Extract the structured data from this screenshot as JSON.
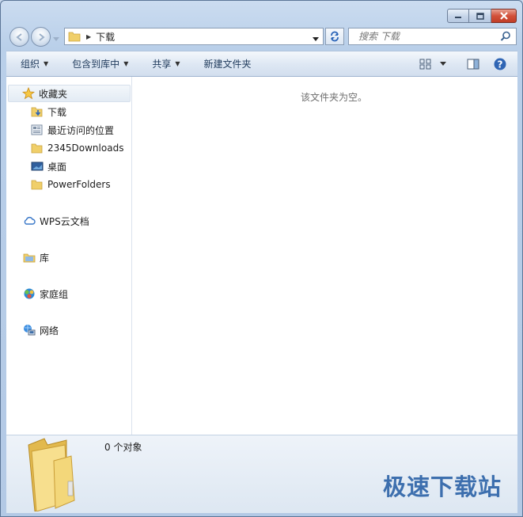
{
  "window": {
    "caption_buttons": [
      "minimize-icon",
      "maximize-icon",
      "close-icon"
    ]
  },
  "address_bar": {
    "path": "下载"
  },
  "search": {
    "placeholder": "搜索 下载"
  },
  "toolbar": {
    "organize": "组织",
    "include_in_library": "包含到库中",
    "share": "共享",
    "new_folder": "新建文件夹"
  },
  "nav": {
    "favorites": "收藏夹",
    "fav_items": [
      {
        "label": "下载",
        "icon": "download-folder-icon"
      },
      {
        "label": "最近访问的位置",
        "icon": "recent-places-icon"
      },
      {
        "label": "2345Downloads",
        "icon": "folder-icon"
      },
      {
        "label": "桌面",
        "icon": "desktop-icon"
      },
      {
        "label": "PowerFolders",
        "icon": "folder-icon"
      }
    ],
    "wps": "WPS云文档",
    "library": "库",
    "homegroup": "家庭组",
    "network": "网络"
  },
  "content": {
    "empty_message": "该文件夹为空。"
  },
  "status": {
    "count": "0 个对象"
  },
  "watermark": "极速下载站",
  "colors": {
    "accent": "#3d6fae",
    "close": "#c9452e",
    "folder": "#f3d77a"
  }
}
